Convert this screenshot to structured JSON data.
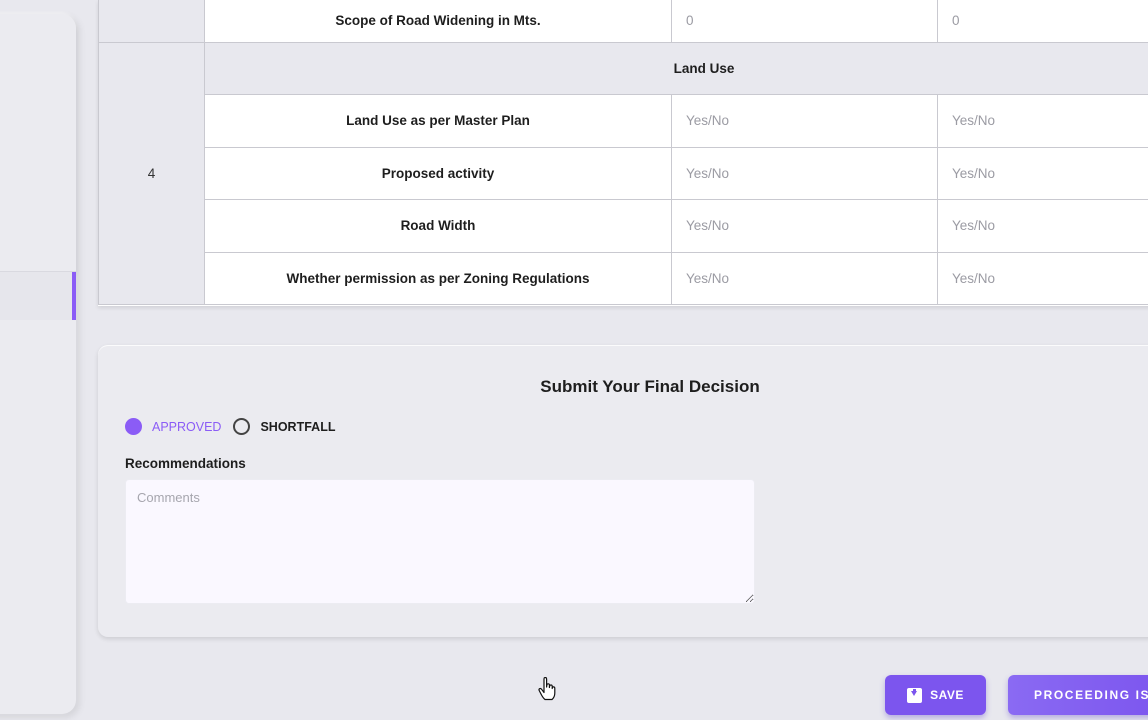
{
  "table": {
    "road_widening": {
      "label": "Scope of Road Widening in Mts.",
      "value1": "0",
      "value2": "0"
    },
    "section": {
      "sno": "4",
      "title": "Land Use"
    },
    "rows": [
      {
        "label": "Land Use as per Master Plan",
        "value1": "Yes/No",
        "value2": "Yes/No"
      },
      {
        "label": "Proposed activity",
        "value1": "Yes/No",
        "value2": "Yes/No"
      },
      {
        "label": "Road Width",
        "value1": "Yes/No",
        "value2": "Yes/No"
      },
      {
        "label": "Whether permission as per Zoning Regulations",
        "value1": "Yes/No",
        "value2": "Yes/No"
      }
    ]
  },
  "decision": {
    "title": "Submit Your Final Decision",
    "options": [
      {
        "label": "APPROVED",
        "selected": true
      },
      {
        "label": "SHORTFALL",
        "selected": false
      }
    ],
    "recommendations_label": "Recommendations",
    "comments_placeholder": "Comments"
  },
  "buttons": {
    "save": "SAVE",
    "proceeding": "PROCEEDING ISS"
  },
  "colors": {
    "accent": "#8b5cf6",
    "button": "#7c55ee",
    "background": "#e8e8ee"
  },
  "icons": {
    "save": "save-icon",
    "cursor": "hand-pointer-icon"
  }
}
